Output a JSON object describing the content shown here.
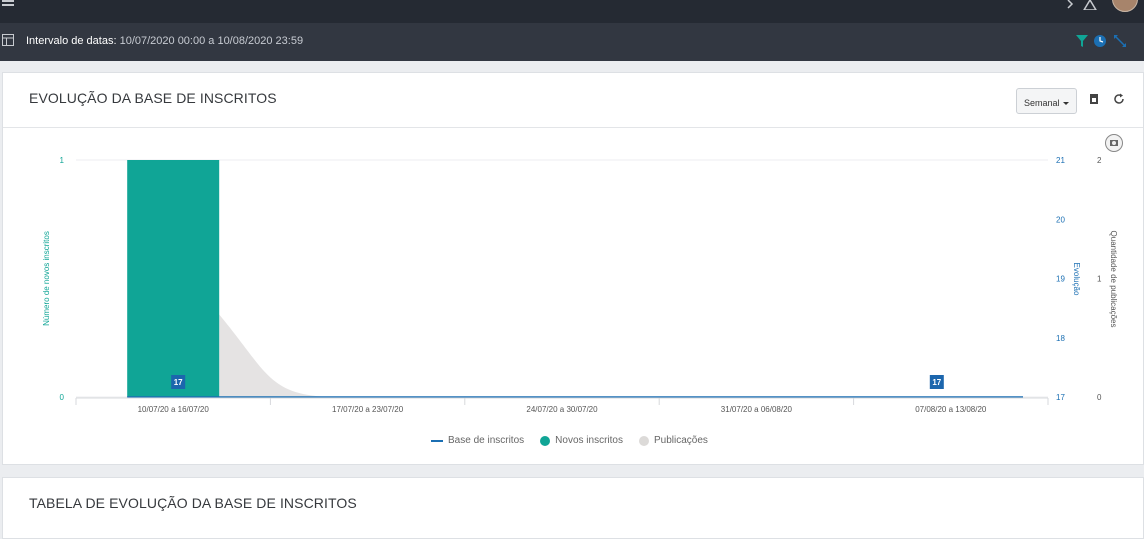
{
  "header": {
    "date_range_label": "Intervalo de datas",
    "date_range_value": "10/07/2020 00:00 a 10/08/2020 23:59"
  },
  "colors": {
    "topbar": "#252a33",
    "subbar": "#323741",
    "accent_teal": "#10a596",
    "accent_blue": "#1b6fb3",
    "publicacoes_gray": "#e4e2e1"
  },
  "icons": [
    "menu-icon",
    "dashboard-icon",
    "filter-icon",
    "clock-icon",
    "expand-icon",
    "export-icon",
    "refresh-icon",
    "camera-icon"
  ],
  "panel1": {
    "title": "EVOLUÇÃO DA BASE DE INSCRITOS",
    "period_select": "Semanal",
    "chart_data": {
      "type": "bar",
      "categories": [
        "10/07/20 a 16/07/20",
        "17/07/20 a 23/07/20",
        "24/07/20 a 30/07/20",
        "31/07/20 a 06/08/20",
        "07/08/20 a 13/08/20"
      ],
      "series": [
        {
          "name": "Base de inscritos",
          "type": "line",
          "axis": "Evolução",
          "values": [
            17,
            17,
            17,
            17,
            17
          ]
        },
        {
          "name": "Novos inscritos",
          "type": "bar",
          "axis": "Número de novos inscritos",
          "values": [
            1,
            0,
            0,
            0,
            0
          ]
        },
        {
          "name": "Publicações",
          "type": "area",
          "axis": "Quantidade de publicações",
          "values": [
            1,
            0,
            0,
            0,
            0
          ]
        }
      ],
      "y_left": {
        "label": "Número de novos inscritos",
        "ticks": [
          "0",
          "1"
        ],
        "range": [
          0,
          1
        ]
      },
      "y_right1": {
        "label": "Evolução",
        "ticks": [
          "17",
          "18",
          "19",
          "20",
          "21"
        ],
        "range": [
          17,
          21
        ]
      },
      "y_right2": {
        "label": "Quantidade de publicações",
        "ticks": [
          "0",
          "1",
          "2"
        ],
        "range": [
          0,
          2
        ]
      },
      "data_labels": [
        "17",
        "17"
      ],
      "legend": [
        "Base de inscritos",
        "Novos inscritos",
        "Publicações"
      ]
    }
  },
  "panel2": {
    "title": "TABELA DE EVOLUÇÃO DA BASE DE INSCRITOS"
  }
}
